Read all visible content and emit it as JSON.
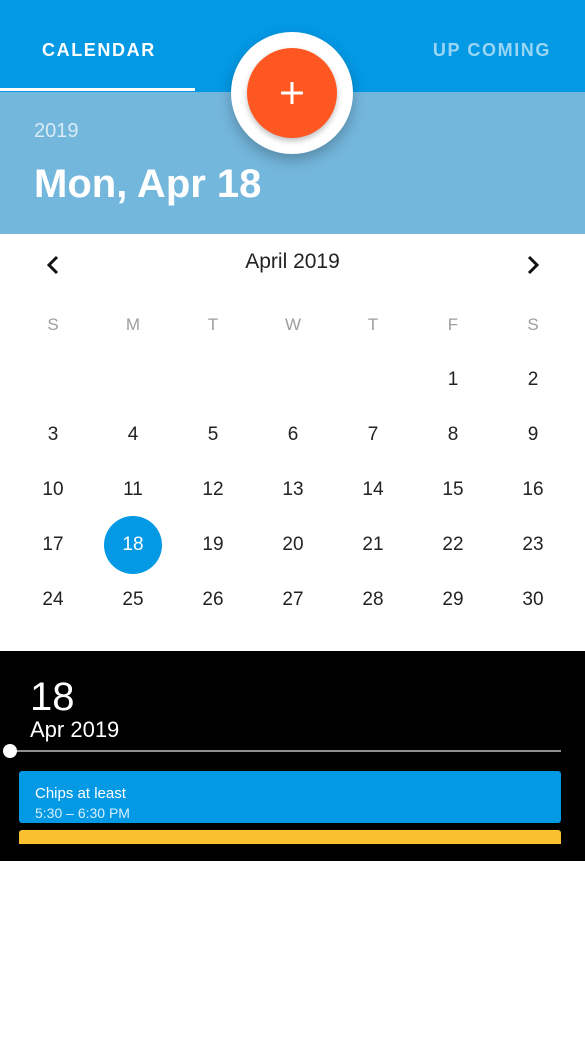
{
  "tabs": {
    "calendar": "CALENDAR",
    "upcoming": "UP COMING"
  },
  "header": {
    "year": "2019",
    "date": "Mon, Apr 18"
  },
  "fab": {
    "icon": "plus-icon"
  },
  "calendar": {
    "month_title": "April 2019",
    "prev_icon": "chevron-left-icon",
    "next_icon": "chevron-right-icon",
    "weekdays": [
      "S",
      "M",
      "",
      "T",
      "W",
      "T",
      "F",
      "S"
    ],
    "weeks": [
      [
        "",
        "",
        "",
        "",
        "",
        "1",
        "2"
      ],
      [
        "3",
        "4",
        "5",
        "6",
        "7",
        "8",
        "9"
      ],
      [
        "10",
        "11",
        "12",
        "13",
        "14",
        "15",
        "16"
      ],
      [
        "17",
        "18",
        "19",
        "20",
        "21",
        "22",
        "23"
      ],
      [
        "24",
        "25",
        "26",
        "27",
        "28",
        "29",
        "30"
      ]
    ],
    "selected": "18"
  },
  "agenda": {
    "day": "18",
    "month": "Apr 2019",
    "events": [
      {
        "title": "Chips at least",
        "time": "5:30 – 6:30 PM"
      }
    ]
  },
  "colors": {
    "primary": "#0399e5",
    "header_light": "#74b7dd",
    "accent": "#ff5722",
    "event_yellow": "#fbc02d"
  }
}
